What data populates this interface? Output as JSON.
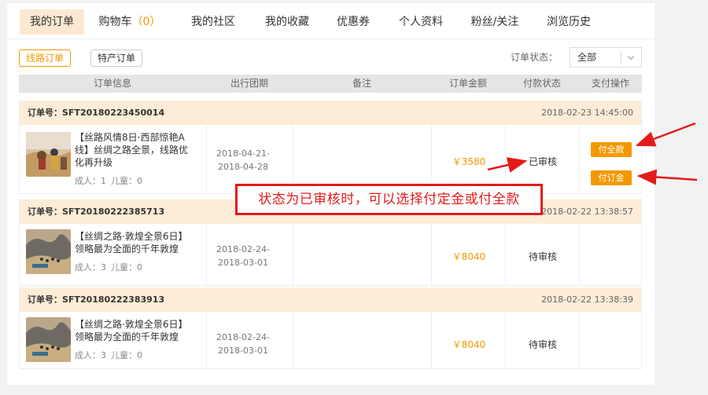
{
  "tabs": [
    {
      "label": "我的订单"
    },
    {
      "label": "购物车",
      "count_open": "（",
      "count": "0",
      "count_close": "）"
    },
    {
      "label": "我的社区"
    },
    {
      "label": "我的收藏"
    },
    {
      "label": "优惠券"
    },
    {
      "label": "个人资料"
    },
    {
      "label": "粉丝/关注"
    },
    {
      "label": "浏览历史"
    }
  ],
  "subtabs": [
    {
      "label": "线路订单"
    },
    {
      "label": "特产订单"
    }
  ],
  "filter": {
    "label": "订单状态：",
    "selected": "全部"
  },
  "table_headers": [
    "订单信息",
    "出行团期",
    "备注",
    "订单金额",
    "付款状态",
    "支付操作"
  ],
  "orders": [
    {
      "order_no": "订单号：SFT20180223450014",
      "time": "2018-02-23 14:45:00",
      "title": "【丝路风情8日·西部惊艳A线】丝绸之路全景，线路优化再升级",
      "adults": "成人：1",
      "children": "儿童：0",
      "date_from": "2018-04-21-",
      "date_to": "2018-04-28",
      "amount": "￥3580",
      "status": "已审核",
      "btn_full": "付全款",
      "btn_deposit": "付订金"
    },
    {
      "order_no": "订单号：SFT20180222385713",
      "time": "2018-02-22 13:38:57",
      "title": "【丝绸之路·敦煌全景6日】领略最为全面的千年敦煌",
      "adults": "成人：3",
      "children": "儿童：0",
      "date_from": "2018-02-24-",
      "date_to": "2018-03-01",
      "amount": "￥8040",
      "status": "待审核"
    },
    {
      "order_no": "订单号：SFT20180222383913",
      "time": "2018-02-22 13:38:39",
      "title": "【丝绸之路·敦煌全景6日】领略最为全面的千年敦煌",
      "adults": "成人：3",
      "children": "儿童：0",
      "date_from": "2018-02-24-",
      "date_to": "2018-03-01",
      "amount": "￥8040",
      "status": "待审核"
    }
  ],
  "annotation": {
    "text": "状态为已审核时，可以选择付定金或付全款",
    "color": "#e31b1b"
  },
  "colors": {
    "accent": "#f39800",
    "order_header_bg": "#fdecd7",
    "active_tab_bg": "#fde9d2"
  }
}
